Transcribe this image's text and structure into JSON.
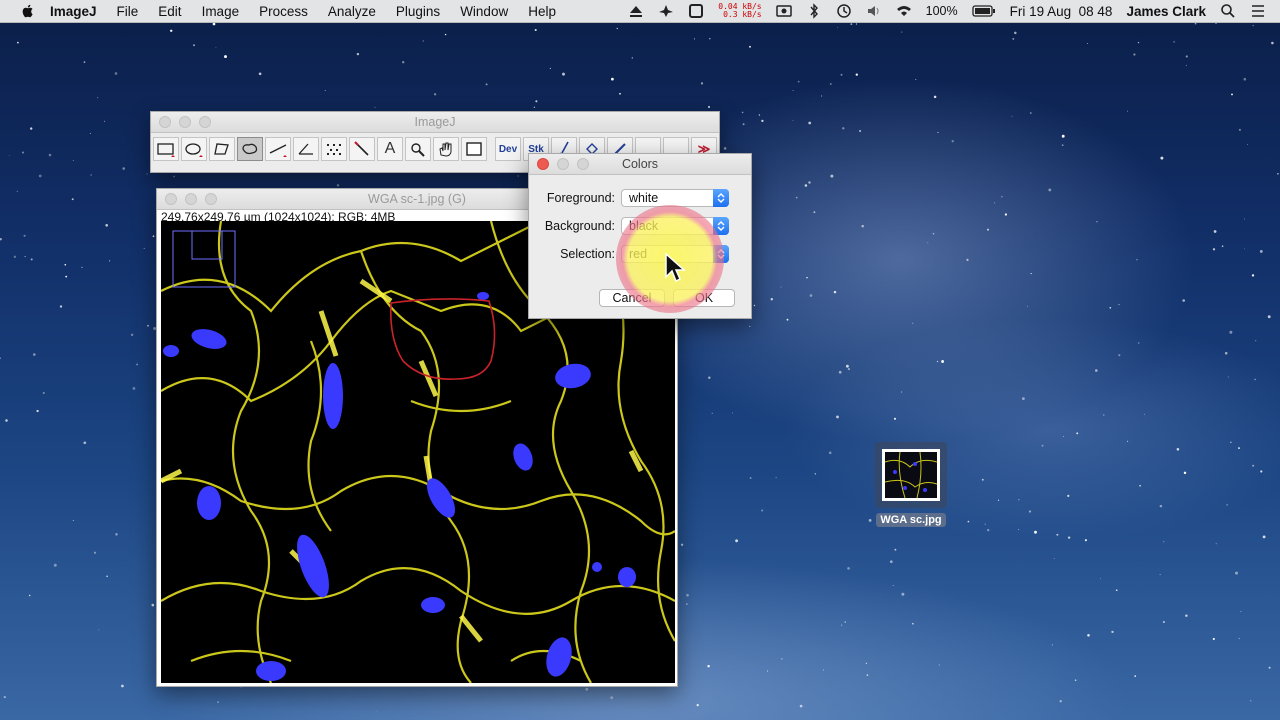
{
  "menubar": {
    "apple_icon": "apple-logo-icon",
    "app_name": "ImageJ",
    "menus": [
      "File",
      "Edit",
      "Image",
      "Process",
      "Analyze",
      "Plugins",
      "Window",
      "Help"
    ],
    "net_up": "0.04 kB/s",
    "net_down": "0.3 kB/s",
    "battery": "100%",
    "datetime": "Fri 19 Aug  08 48",
    "user": "James Clark"
  },
  "imagej_window": {
    "title": "ImageJ",
    "tools": [
      "rectangle",
      "oval",
      "polygon",
      "freehand",
      "line",
      "angle",
      "point",
      "wand",
      "text",
      "magnifier",
      "scroll",
      "color-picker"
    ],
    "selected_tool": "freehand",
    "dev_label": "Dev",
    "stk_label": "Stk",
    "more_label": "≫"
  },
  "image_window": {
    "title": "WGA sc-1.jpg (G)",
    "info": "249.76x249.76 µm (1024x1024); RGB; 4MB"
  },
  "colors_dialog": {
    "title": "Colors",
    "foreground_label": "Foreground:",
    "foreground_value": "white",
    "background_label": "Background:",
    "background_value": "black",
    "selection_label": "Selection:",
    "selection_value": "red",
    "cancel_label": "Cancel",
    "ok_label": "OK"
  },
  "desktop": {
    "file_name": "WGA sc.jpg"
  },
  "colors": {
    "membrane": "#e8e020",
    "nuclei": "#3a3aff",
    "selection": "#c8232a"
  }
}
